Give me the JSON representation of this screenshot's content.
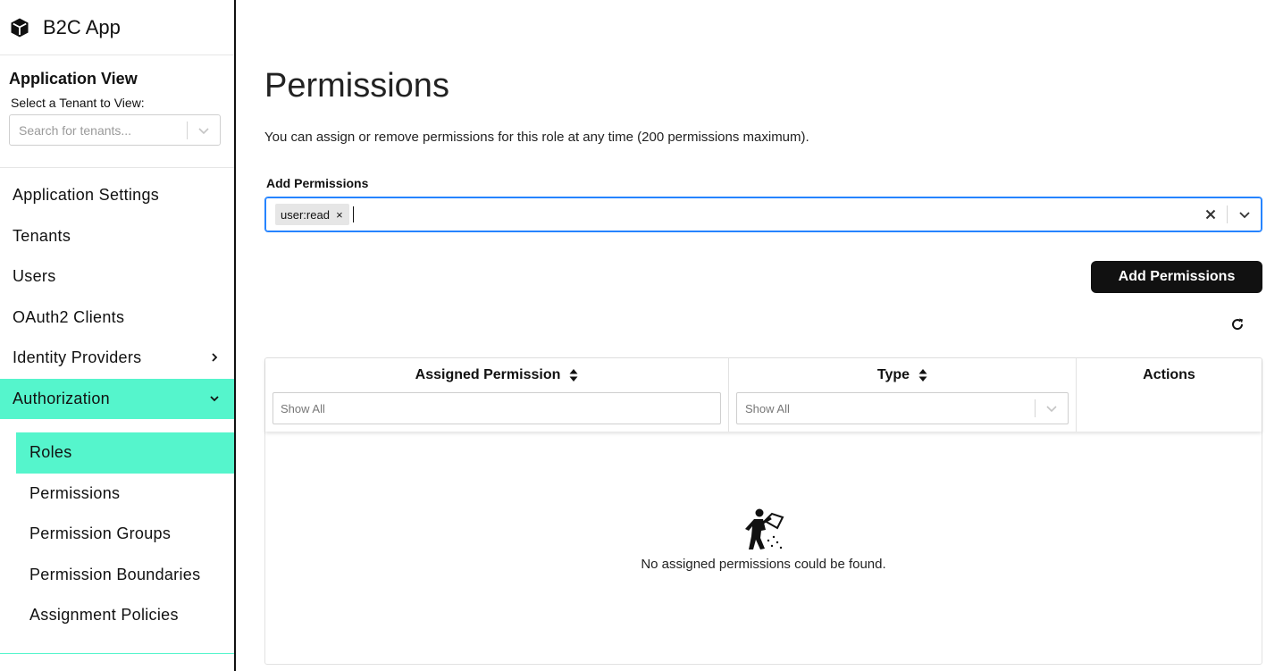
{
  "app": {
    "title": "B2C App",
    "icon": "cube-icon"
  },
  "application_view": {
    "title": "Application View",
    "tenant_label": "Select a Tenant to View:",
    "tenant_placeholder": "Search for tenants..."
  },
  "nav": {
    "items": [
      {
        "label": "Application Settings"
      },
      {
        "label": "Tenants"
      },
      {
        "label": "Users"
      },
      {
        "label": "OAuth2 Clients"
      },
      {
        "label": "Identity Providers",
        "icon": "chevron-right-icon"
      },
      {
        "label": "Authorization",
        "icon": "chevron-down-icon",
        "active": true
      }
    ],
    "sub_items": [
      {
        "label": "Roles",
        "active": true
      },
      {
        "label": "Permissions"
      },
      {
        "label": "Permission Groups"
      },
      {
        "label": "Permission Boundaries"
      },
      {
        "label": "Assignment Policies"
      }
    ]
  },
  "main": {
    "title": "Permissions",
    "description": "You can assign or remove permissions for this role at any time (200 permissions maximum).",
    "add_label": "Add Permissions",
    "selected_chips": [
      "user:read"
    ],
    "chip_remove": "×",
    "add_button": "Add Permissions",
    "accent_color": "#55f5cc",
    "focus_color": "#2684ff"
  },
  "table": {
    "columns": [
      {
        "label": "Assigned Permission",
        "filter_placeholder": "Show All"
      },
      {
        "label": "Type",
        "filter_value": "Show All"
      },
      {
        "label": "Actions"
      }
    ],
    "empty_message": "No assigned permissions could be found."
  }
}
